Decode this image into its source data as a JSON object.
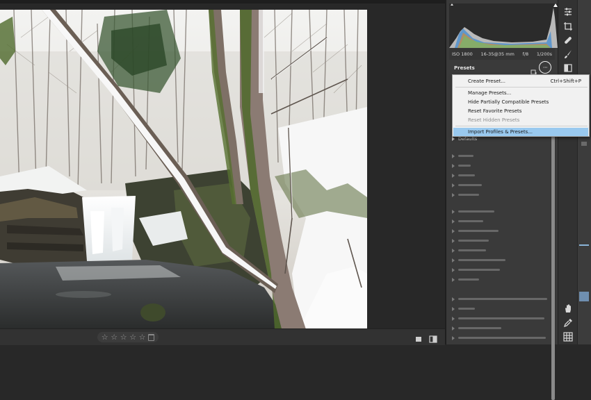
{
  "photo": {
    "description_icon": "image-preview",
    "colors": {
      "snow": "#f4f4f4",
      "moss": "#4f6a2c",
      "water": "#3b3e3d",
      "bark": "#8d7a6b"
    }
  },
  "camera_info": {
    "iso": "ISO 1800",
    "lens": "16-35@35 mm",
    "aperture": "f/8",
    "shutter": "1/200s"
  },
  "presets_panel": {
    "title": "Presets",
    "more_button_label": "···"
  },
  "context_menu": {
    "items": [
      {
        "label": "Create Preset...",
        "shortcut": "Ctrl+Shift+P",
        "state": "normal"
      },
      {
        "label": "Manage Presets...",
        "state": "normal"
      },
      {
        "label": "Hide Partially Compatible Presets",
        "state": "normal"
      },
      {
        "label": "Reset Favorite Presets",
        "state": "normal"
      },
      {
        "label": "Reset Hidden Presets",
        "state": "disabled"
      },
      {
        "label": "Import Profiles & Presets...",
        "state": "highlighted"
      }
    ]
  },
  "preset_groups": {
    "defaults": "Defaults"
  },
  "rating": {
    "stars": [
      "☆",
      "☆",
      "☆",
      "☆",
      "☆"
    ],
    "value": 0
  },
  "accent_colors": {
    "menu_highlight": "#99c9ef",
    "panel_bg": "#3a3a3a"
  }
}
